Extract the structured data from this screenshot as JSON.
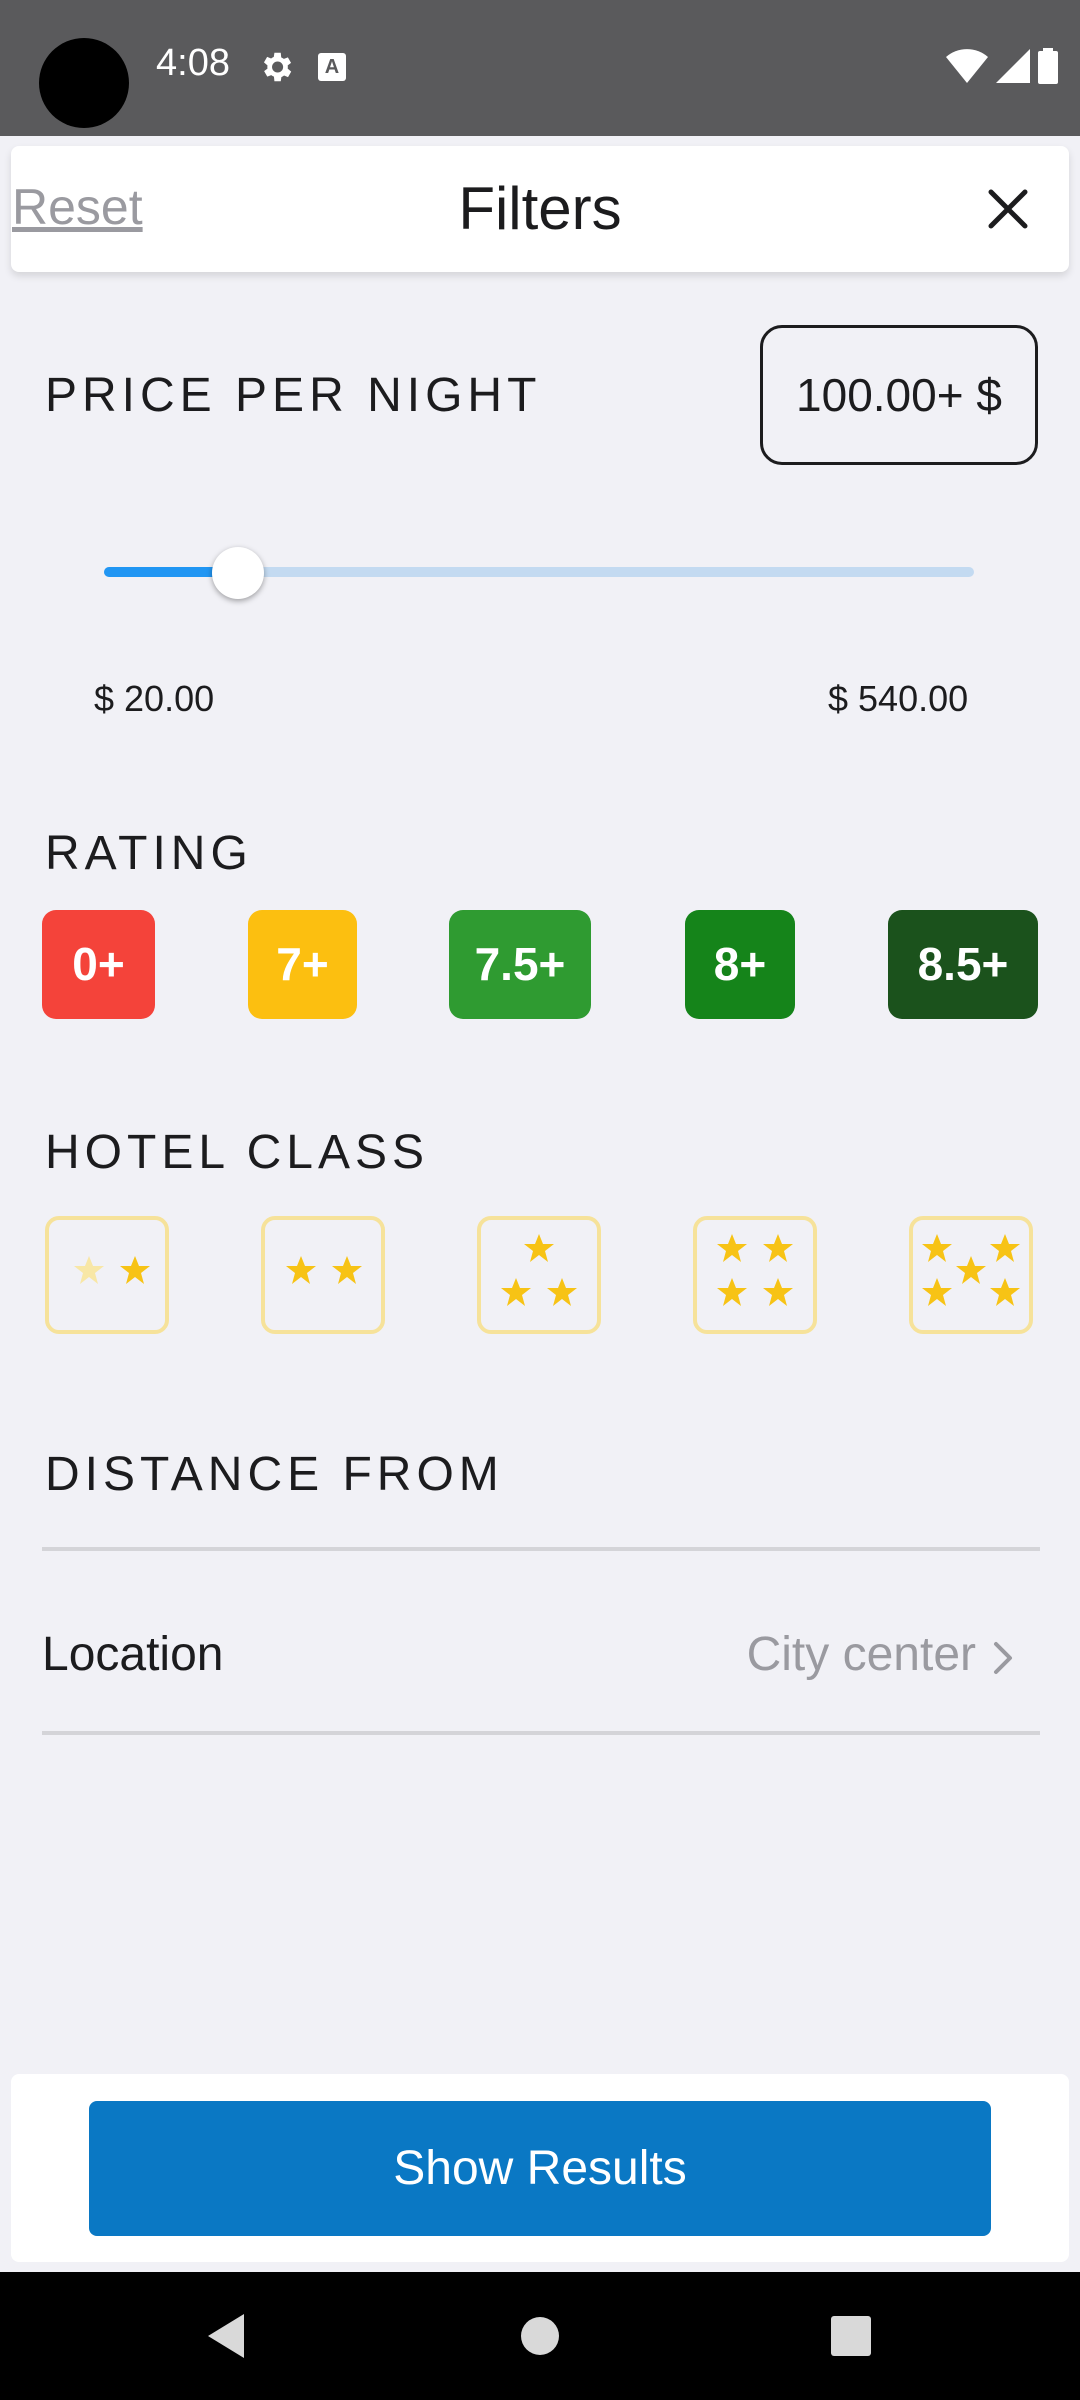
{
  "status_bar": {
    "time": "4:08"
  },
  "header": {
    "reset_label": "Reset",
    "title": "Filters"
  },
  "price": {
    "section_title": "PRICE PER NIGHT",
    "selected_display": "100.00+ $",
    "min_label": "$ 20.00",
    "max_label": "$ 540.00",
    "min_value": 20,
    "max_value": 540,
    "selected_value": 100
  },
  "rating": {
    "section_title": "RATING",
    "options": [
      {
        "label": "0+",
        "color": "#f4433a"
      },
      {
        "label": "7+",
        "color": "#fcbf10"
      },
      {
        "label": "7.5+",
        "color": "#2f9b31"
      },
      {
        "label": "8+",
        "color": "#15841a"
      },
      {
        "label": "8.5+",
        "color": "#1b521c"
      }
    ]
  },
  "hotel_class": {
    "section_title": "HOTEL CLASS",
    "options": [
      {
        "stars": 1.5
      },
      {
        "stars": 2
      },
      {
        "stars": 3
      },
      {
        "stars": 4
      },
      {
        "stars": 5
      }
    ]
  },
  "distance": {
    "section_title": "DISTANCE FROM",
    "location_label": "Location",
    "location_value": "City center"
  },
  "footer": {
    "show_results_label": "Show Results"
  },
  "colors": {
    "accent": "#0a78c4",
    "slider": "#2196f3",
    "star": "#f7c315",
    "star_border": "#f6e29a"
  }
}
